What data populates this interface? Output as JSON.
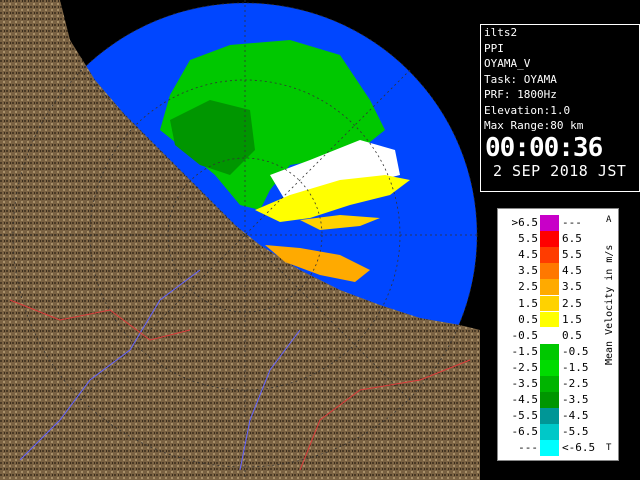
{
  "info": {
    "product": "ilts2",
    "scan_type": "PPI",
    "site": "OYAMA_V",
    "task": "Task: OYAMA",
    "prf": "PRF: 1800Hz",
    "elevation": "Elevation:1.0",
    "max_range": "Max Range:80 km",
    "time": "00:00:36",
    "date": "2 SEP 2018 JST"
  },
  "legend": {
    "title": "Mean Velocity in m/s",
    "corner_top": "A",
    "corner_bottom": "T",
    "rows": [
      {
        "lo": ">6.5",
        "hi": "---",
        "color": "#c800c8"
      },
      {
        "lo": "5.5",
        "hi": "6.5",
        "color": "#ff0000"
      },
      {
        "lo": "4.5",
        "hi": "5.5",
        "color": "#ff3c00"
      },
      {
        "lo": "3.5",
        "hi": "4.5",
        "color": "#ff7800"
      },
      {
        "lo": "2.5",
        "hi": "3.5",
        "color": "#ffaa00"
      },
      {
        "lo": "1.5",
        "hi": "2.5",
        "color": "#ffd200"
      },
      {
        "lo": "0.5",
        "hi": "1.5",
        "color": "#ffff00"
      },
      {
        "lo": "-0.5",
        "hi": "0.5",
        "color": "#ffffff"
      },
      {
        "lo": "-1.5",
        "hi": "-0.5",
        "color": "#00c800"
      },
      {
        "lo": "-2.5",
        "hi": "-1.5",
        "color": "#00dc00"
      },
      {
        "lo": "-3.5",
        "hi": "-2.5",
        "color": "#00b400"
      },
      {
        "lo": "-4.5",
        "hi": "-3.5",
        "color": "#009600"
      },
      {
        "lo": "-5.5",
        "hi": "-4.5",
        "color": "#009696"
      },
      {
        "lo": "-6.5",
        "hi": "-5.5",
        "color": "#00c8c8"
      },
      {
        "lo": "---",
        "hi": "<-6.5",
        "color": "#00ffff"
      }
    ]
  },
  "colors": {
    "land": "#7a6243",
    "sea_far": "#0046ff",
    "sea_near": "#1e78ff",
    "rivers": "#6464ff",
    "boundaries": "#dc3c3c"
  }
}
